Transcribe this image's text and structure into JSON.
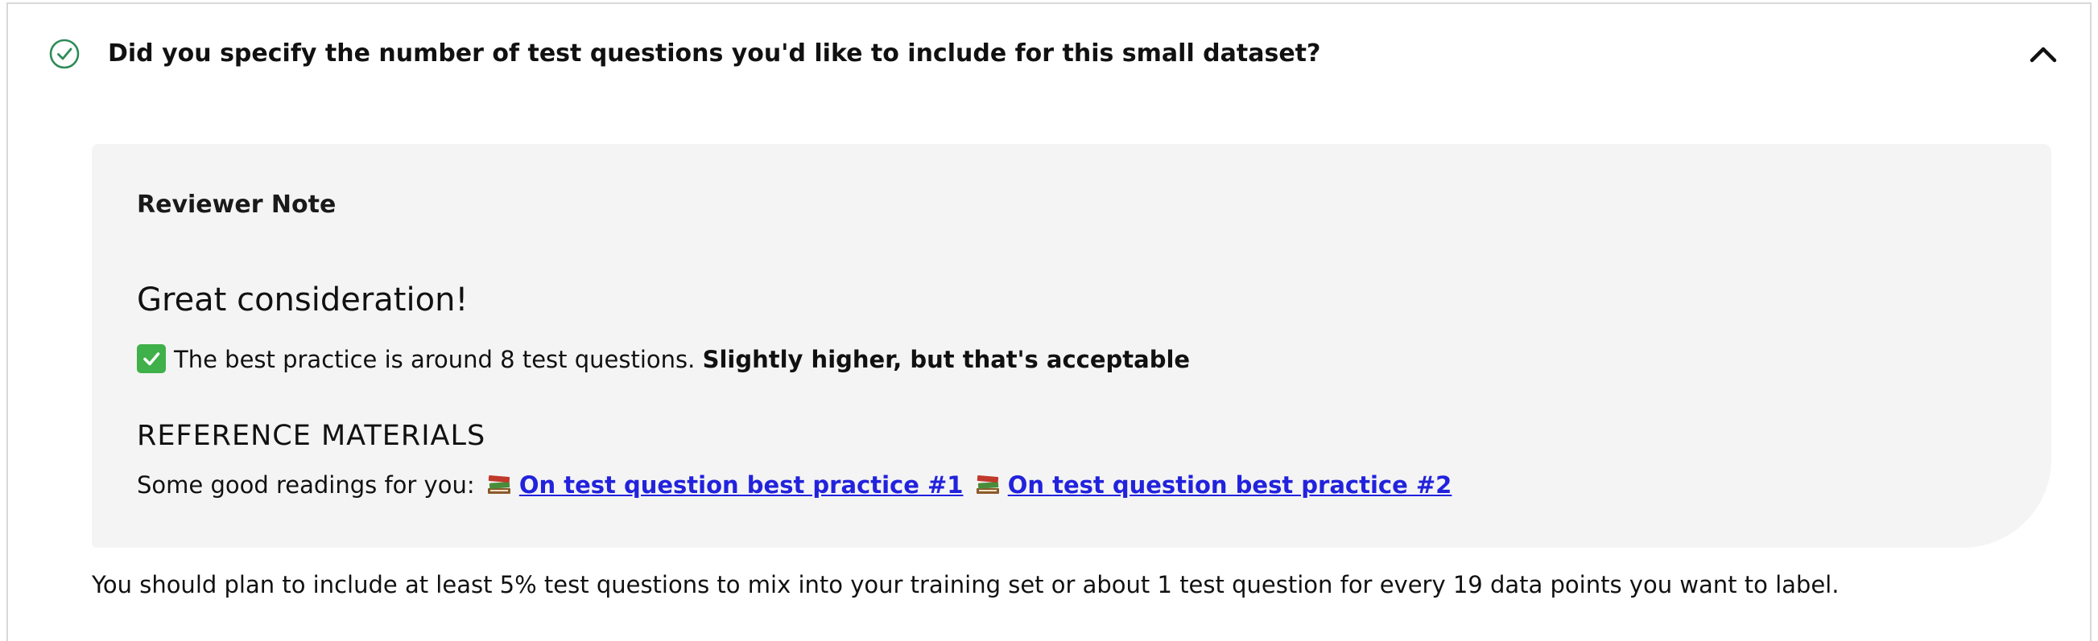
{
  "question": {
    "status_icon": "check-circle-icon",
    "text": "Did you specify the number of test questions you'd like to include for this small dataset?",
    "toggle_icon": "chevron-up-icon"
  },
  "reviewer_note": {
    "label": "Reviewer Note",
    "title": "Great consideration!",
    "line_prefix": "The best practice is around 8 test questions.",
    "line_emphasis": "Slightly higher, but that's acceptable",
    "reference_heading": "REFERENCE MATERIALS",
    "readings_prefix": "Some good readings for you:",
    "links": [
      {
        "label": "On test question best practice #1"
      },
      {
        "label": "On test question best practice #2"
      }
    ]
  },
  "footer": {
    "text": "You should plan to include at least 5% test questions to mix into your training set or about 1 test question for every 19 data points you want to label."
  },
  "colors": {
    "accent_green": "#2e8b57",
    "link_blue": "#2222dd",
    "note_background": "#f4f4f4",
    "border": "#d8d8d8"
  }
}
